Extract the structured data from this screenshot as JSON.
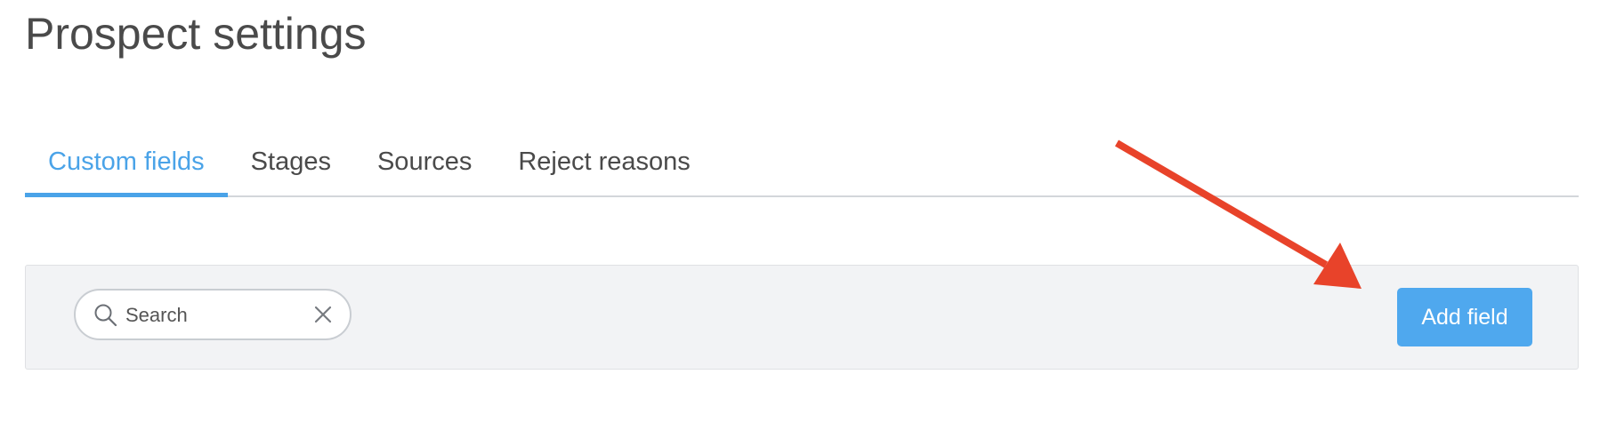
{
  "page": {
    "title": "Prospect settings"
  },
  "tabs": [
    {
      "label": "Custom fields",
      "active": true
    },
    {
      "label": "Stages",
      "active": false
    },
    {
      "label": "Sources",
      "active": false
    },
    {
      "label": "Reject reasons",
      "active": false
    }
  ],
  "toolbar": {
    "search": {
      "placeholder": "Search",
      "value": "",
      "icon": "search-icon",
      "clear_icon": "close-icon"
    },
    "add_button_label": "Add field"
  },
  "annotation": {
    "icon": "arrow-icon",
    "color": "#e8432a"
  },
  "colors": {
    "accent": "#4aa3e8",
    "button": "#4fa8ee",
    "panel": "#f2f3f5"
  }
}
